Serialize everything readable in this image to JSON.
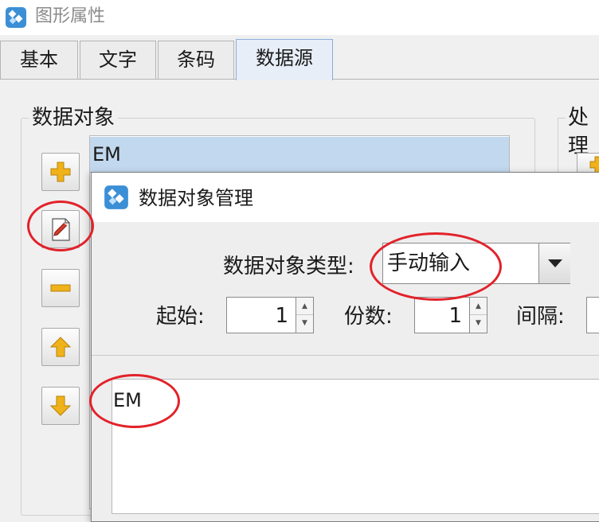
{
  "window": {
    "title": "图形属性"
  },
  "tabs": [
    {
      "label": "基本",
      "active": false
    },
    {
      "label": "文字",
      "active": false
    },
    {
      "label": "条码",
      "active": false
    },
    {
      "label": "数据源",
      "active": true
    }
  ],
  "data_object_group": {
    "legend": "数据对象",
    "list_items": [
      "EM"
    ],
    "buttons": [
      {
        "name": "add-button",
        "icon": "plus-icon"
      },
      {
        "name": "edit-button",
        "icon": "edit-icon"
      },
      {
        "name": "remove-button",
        "icon": "minus-icon"
      },
      {
        "name": "move-up-button",
        "icon": "arrow-up-icon"
      },
      {
        "name": "move-down-button",
        "icon": "arrow-down-icon"
      }
    ]
  },
  "process_group": {
    "legend": "处理"
  },
  "dialog": {
    "title": "数据对象管理",
    "type_label": "数据对象类型:",
    "type_value": "手动输入",
    "start_label": "起始:",
    "start_value": "1",
    "copies_label": "份数:",
    "copies_value": "1",
    "interval_label": "间隔:",
    "content": "EM"
  },
  "colors": {
    "highlight": "#e2222a",
    "selected_row": "#c2d8ee",
    "icon_yellow": "#f0b21a"
  }
}
